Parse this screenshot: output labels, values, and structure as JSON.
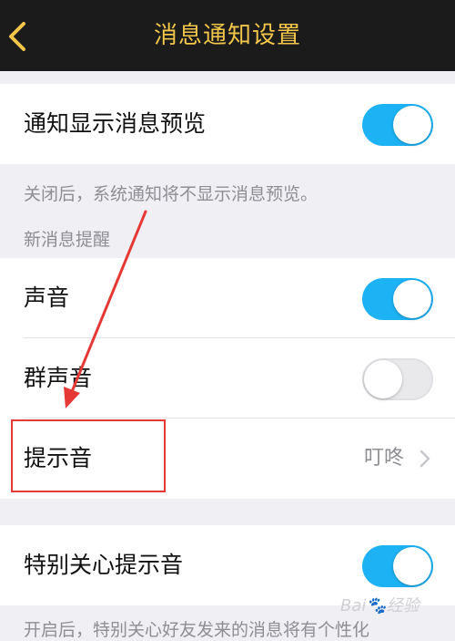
{
  "header": {
    "title": "消息通知设置",
    "back_icon": "chevron-left-icon"
  },
  "rows": {
    "preview": {
      "label": "通知显示消息预览",
      "toggle_on": true
    },
    "sound": {
      "label": "声音",
      "toggle_on": true
    },
    "group_sound": {
      "label": "群声音",
      "toggle_on": false
    },
    "tone": {
      "label": "提示音",
      "value": "叮咚"
    },
    "special_tone": {
      "label": "特别关心提示音",
      "toggle_on": true
    }
  },
  "notes": {
    "preview_note": "关闭后，系统通知将不显示消息预览。",
    "section_header": "新消息提醒",
    "special_note": "开启后，特别关心好友发来的消息将有个性化"
  },
  "watermark": "Bai🐾经验",
  "colors": {
    "navbar_bg": "#1b1b1b",
    "title_gold": "#f2c64a",
    "toggle_on": "#1db2f4",
    "annotation_red": "#e53935"
  }
}
